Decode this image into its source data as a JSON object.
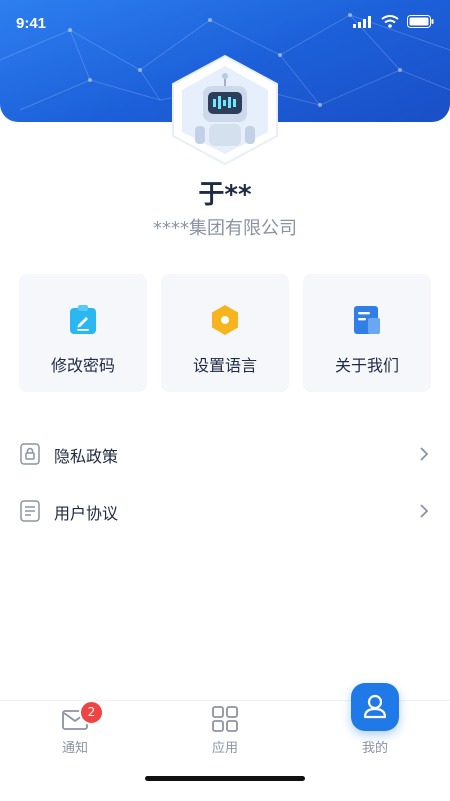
{
  "status_bar": {
    "time": "9:41"
  },
  "profile": {
    "name": "于**",
    "company": "****集团有限公司"
  },
  "quick_actions": [
    {
      "label": "修改密码",
      "icon": "edit-clipboard-icon",
      "color": "#2bb7f0"
    },
    {
      "label": "设置语言",
      "icon": "hexagon-settings-icon",
      "color": "#f6b51e"
    },
    {
      "label": "关于我们",
      "icon": "document-icon",
      "color": "#2f7fe6"
    }
  ],
  "menu": [
    {
      "label": "隐私政策",
      "icon": "privacy-lock-icon"
    },
    {
      "label": "用户协议",
      "icon": "agreement-doc-icon"
    }
  ],
  "tabbar": {
    "items": [
      {
        "label": "通知",
        "icon": "mail-icon",
        "badge": "2"
      },
      {
        "label": "应用",
        "icon": "grid-icon"
      },
      {
        "label": "我的",
        "icon": "user-icon",
        "active": true
      }
    ]
  },
  "colors": {
    "primary": "#1f7ae8",
    "header": "#1c5fd8",
    "badge": "#ef4444"
  }
}
